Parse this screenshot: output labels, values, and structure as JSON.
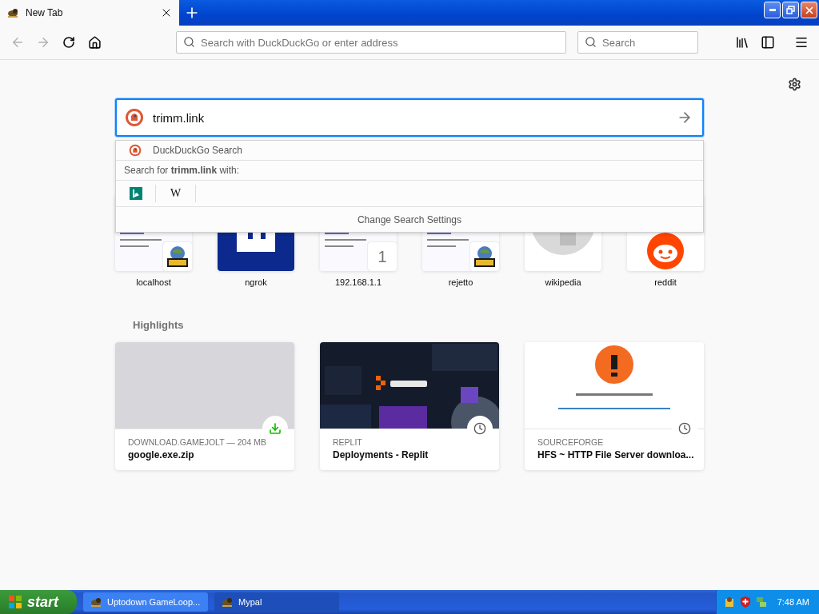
{
  "tab": {
    "title": "New Tab",
    "selected": true
  },
  "toolbar": {
    "address_placeholder": "Search with DuckDuckGo or enter address",
    "search_placeholder": "Search",
    "forward_disabled": true
  },
  "search": {
    "value": "trimm.link",
    "suggestions": [
      {
        "label": "DuckDuckGo Search"
      }
    ],
    "search_for": "Search for **trimm.link** with:",
    "engines": [
      {
        "kind": "bing"
      },
      {
        "kind": "wikipedia",
        "glyph": "W"
      }
    ],
    "settings_label": "Change Search Settings"
  },
  "top_sites": [
    {
      "label": "localhost",
      "kind": "hfs"
    },
    {
      "label": "ngrok",
      "kind": "ngrok"
    },
    {
      "label": "192.168.1.1",
      "kind": "letter",
      "badge_text": "1"
    },
    {
      "label": "rejetto",
      "kind": "hfs"
    },
    {
      "label": "wikipedia",
      "kind": "wikipedia"
    },
    {
      "label": "reddit",
      "kind": "reddit"
    }
  ],
  "highlights": {
    "heading": "Highlights",
    "cards": [
      {
        "source": "DOWNLOAD.GAMEJOLT — 204 MB",
        "title": "google.exe.zip",
        "kind": "download"
      },
      {
        "source": "REPLIT",
        "title": "Deployments - Replit",
        "kind": "history"
      },
      {
        "source": "SOURCEFORGE",
        "title": "HFS ~ HTTP File Server downloa...",
        "kind": "history"
      }
    ]
  },
  "taskbar": {
    "start": "start",
    "tasks": [
      {
        "label": "Uptodown GameLoop...",
        "selected": false
      },
      {
        "label": "Mypal",
        "selected": true
      }
    ],
    "clock": "7:48 AM"
  }
}
